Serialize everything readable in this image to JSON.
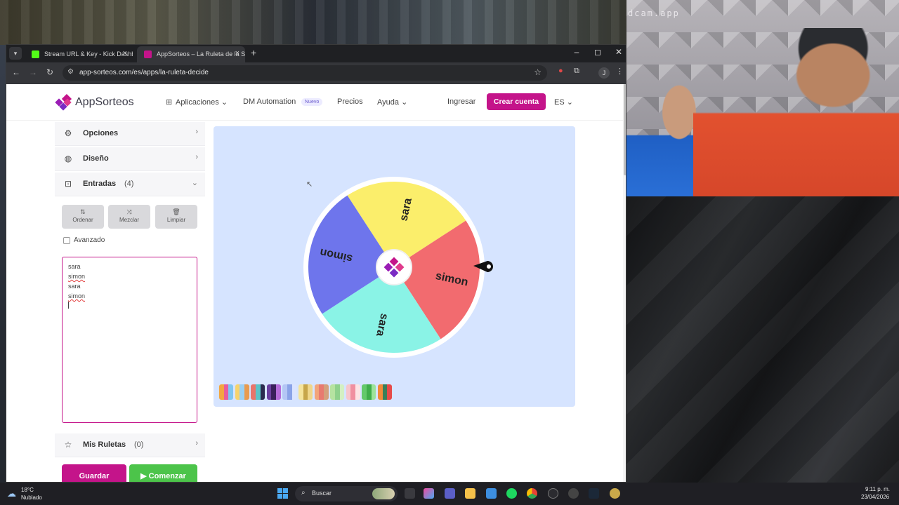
{
  "stream": {
    "webcam_label": "dcam.app"
  },
  "browser": {
    "tabs": [
      {
        "title": "Stream URL & Key - Kick Dashb",
        "active": false
      },
      {
        "title": "AppSorteos – La Ruleta de la Su",
        "active": true
      }
    ],
    "url": "app-sorteos.com/es/apps/la-ruleta-decide",
    "profile_initial": "J"
  },
  "site": {
    "logo": "AppSorteos",
    "nav": {
      "aplicaciones": "Aplicaciones",
      "dm_automation": "DM Automation",
      "badge_nuevo": "Nuevo",
      "precios": "Precios",
      "ayuda": "Ayuda"
    },
    "login": "Ingresar",
    "signup": "Crear cuenta",
    "language": "ES",
    "brand_color": "#c4148a"
  },
  "sidebar": {
    "opciones": "Opciones",
    "diseno": "Diseño",
    "entradas": "Entradas",
    "entradas_count": "(4)",
    "tools": {
      "ordenar": "Ordenar",
      "mezclar": "Mezclar",
      "limpiar": "Limpiar"
    },
    "avanzado": "Avanzado",
    "entries": [
      "sara",
      "simon",
      "sara",
      "simon"
    ],
    "mis_ruletas": "Mis Ruletas",
    "mis_ruletas_count": "(0)",
    "guardar": "Guardar",
    "comenzar": "Comenzar"
  },
  "wheel": {
    "segments": [
      {
        "label": "sara",
        "color": "#fbee6b"
      },
      {
        "label": "simon",
        "color": "#f26b6f"
      },
      {
        "label": "sara",
        "color": "#8af3e6"
      },
      {
        "label": "simon",
        "color": "#6e75ec"
      }
    ],
    "palettes": [
      [
        "#f3a640",
        "#e85d9c",
        "#7fc6f0"
      ],
      [
        "#f6d36b",
        "#9ad0f5",
        "#e89b50"
      ],
      [
        "#e8746b",
        "#5cc3c8",
        "#2b2b4f"
      ],
      [
        "#6b3fa0",
        "#3a1f5c",
        "#b56bd9"
      ],
      [
        "#b4c6f5",
        "#8aa3e8",
        "#dbe4ff"
      ],
      [
        "#f5e49c",
        "#c7a64a",
        "#efd68a"
      ],
      [
        "#f2a47a",
        "#e87a70",
        "#d4a07c"
      ],
      [
        "#b6e3a1",
        "#8fd18c",
        "#d3f0c2"
      ],
      [
        "#f7c6cc",
        "#f08fa0",
        "#fde2e4"
      ],
      [
        "#63c96b",
        "#3fae4b",
        "#9de39a"
      ],
      [
        "#f18b3a",
        "#3a7f59",
        "#e64a4a"
      ]
    ]
  },
  "taskbar": {
    "temperature": "18°C",
    "weather": "Nublado",
    "search": "Buscar",
    "time": "9:11 p. m.",
    "date": "23/04/2026"
  }
}
